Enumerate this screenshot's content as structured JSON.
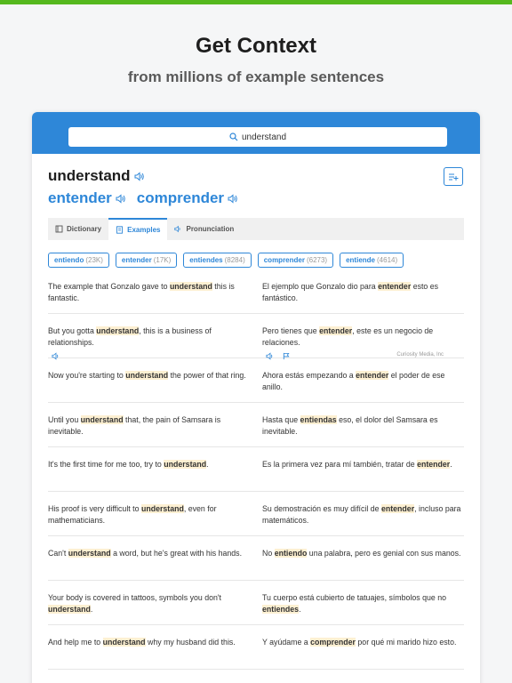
{
  "hero": {
    "title": "Get Context",
    "subtitle": "from millions of example sentences"
  },
  "colors": {
    "accent": "#2e87d8",
    "top_bar": "#55b81e",
    "highlight": "#fdf0d2"
  },
  "search": {
    "query": "understand"
  },
  "word": {
    "headword": "understand",
    "translations": [
      "entender",
      "comprender"
    ]
  },
  "tabs": [
    {
      "label": "Dictionary",
      "icon": "book-icon",
      "active": false
    },
    {
      "label": "Examples",
      "icon": "document-icon",
      "active": true
    },
    {
      "label": "Pronunciation",
      "icon": "speaker-icon",
      "active": false
    }
  ],
  "chips": [
    {
      "word": "entiendo",
      "count": "(23K)"
    },
    {
      "word": "entender",
      "count": "(17K)"
    },
    {
      "word": "entiendes",
      "count": "(8284)"
    },
    {
      "word": "comprender",
      "count": "(6273)"
    },
    {
      "word": "entiende",
      "count": "(4614)"
    }
  ],
  "credit": "Curiosity Media, Inc",
  "examples": [
    {
      "en": [
        "The example that Gonzalo gave to ",
        "understand",
        " this is fantastic."
      ],
      "es": [
        "El ejemplo que Gonzalo dio para ",
        "entender",
        " esto es fantástico."
      ]
    },
    {
      "en": [
        "But you gotta ",
        "understand",
        ", this is a business of relationships."
      ],
      "es": [
        "Pero tienes que ",
        "entender",
        ", este es un negocio de relaciones."
      ]
    },
    {
      "en": [
        "Now you're starting to ",
        "understand",
        " the power of that ring."
      ],
      "es": [
        "Ahora estás empezando a ",
        "entender",
        " el poder de ese anillo."
      ]
    },
    {
      "en": [
        "Until you ",
        "understand",
        " that, the pain of Samsara is inevitable."
      ],
      "es": [
        "Hasta que ",
        "entiendas",
        " eso, el dolor del Samsara es inevitable."
      ]
    },
    {
      "en": [
        "It's the first time for me too, try to ",
        "understand",
        "."
      ],
      "es": [
        "Es la primera vez para mí también, tratar de ",
        "entender",
        "."
      ]
    },
    {
      "en": [
        "His proof is very difficult to ",
        "understand",
        ", even for mathematicians."
      ],
      "es": [
        "Su demostración es muy difícil de ",
        "entender",
        ", incluso para matemáticos."
      ]
    },
    {
      "en": [
        "Can't ",
        "understand",
        " a word, but he's great with his hands."
      ],
      "es": [
        "No ",
        "entiendo",
        " una palabra, pero es genial con sus manos."
      ]
    },
    {
      "en": [
        "Your body is covered in tattoos, symbols you don't ",
        "understand",
        "."
      ],
      "es": [
        "Tu cuerpo está cubierto de tatuajes, símbolos que no ",
        "entiendes",
        "."
      ]
    },
    {
      "en": [
        "And help me to ",
        "understand",
        " why my husband did this."
      ],
      "es": [
        "Y ayúdame a ",
        "comprender",
        " por qué mi marido hizo esto."
      ]
    }
  ]
}
